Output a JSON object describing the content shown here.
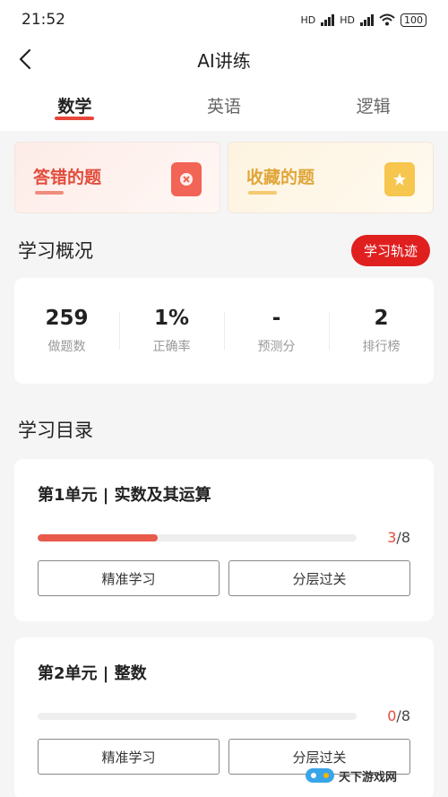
{
  "status_bar": {
    "time": "21:52",
    "hd1": "HD",
    "hd2": "HD",
    "battery": "100"
  },
  "nav": {
    "title": "AI讲练"
  },
  "tabs": [
    {
      "label": "数学",
      "active": true
    },
    {
      "label": "英语",
      "active": false
    },
    {
      "label": "逻辑",
      "active": false
    }
  ],
  "shortcuts": {
    "wrong_label": "答错的题",
    "fav_label": "收藏的题"
  },
  "overview": {
    "title": "学习概况",
    "track_button": "学习轨迹",
    "stats": [
      {
        "value": "259",
        "label": "做题数"
      },
      {
        "value": "1%",
        "label": "正确率"
      },
      {
        "value": "-",
        "label": "预测分"
      },
      {
        "value": "2",
        "label": "排行榜"
      }
    ]
  },
  "catalog": {
    "title": "学习目录",
    "units": [
      {
        "title": "第1单元 | 实数及其运算",
        "done": "3",
        "total": "/8",
        "progress": 0.375,
        "btn_precise": "精准学习",
        "btn_level": "分层过关"
      },
      {
        "title": "第2单元 | 整数",
        "done": "0",
        "total": "/8",
        "progress": 0,
        "btn_precise": "精准学习",
        "btn_level": "分层过关"
      }
    ]
  },
  "watermark": {
    "text": "天下游戏网"
  },
  "colors": {
    "accent": "#e8463a",
    "track_button": "#e01f1f",
    "wrong": "#e24c3c",
    "fav": "#e0a63a"
  }
}
